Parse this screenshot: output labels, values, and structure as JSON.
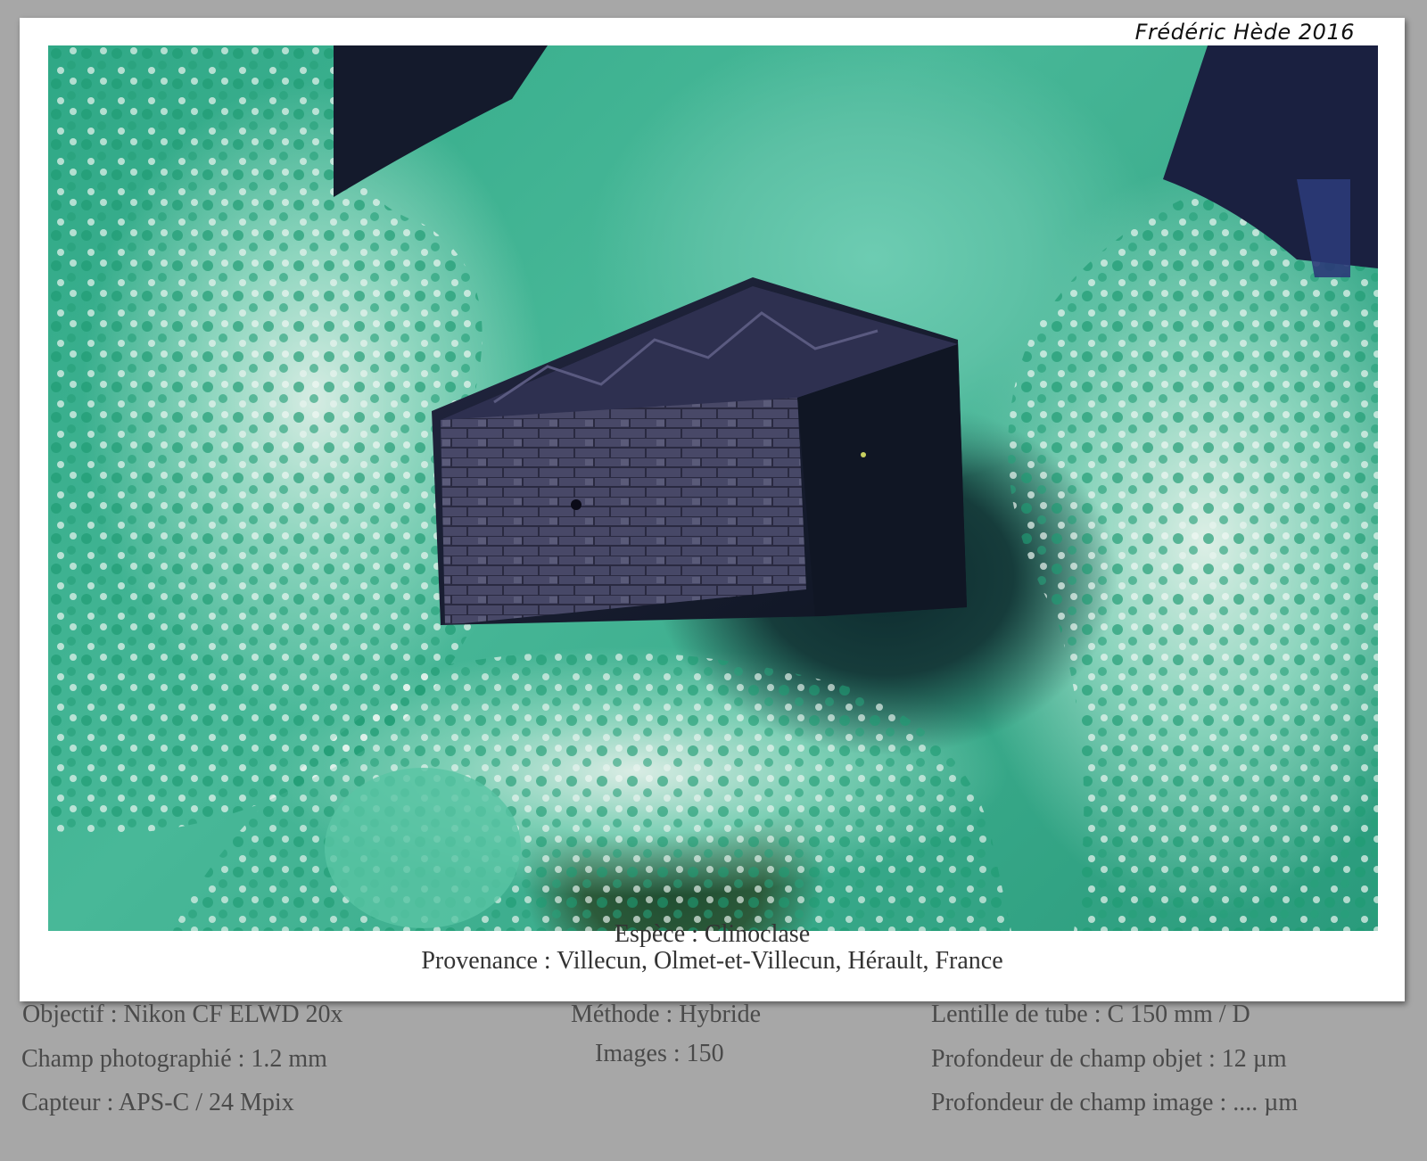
{
  "signature": "Frédéric Hède 2016",
  "caption": {
    "species": "Espèce : Clinoclase",
    "origin": "Provenance : Villecun, Olmet-et-Villecun, Hérault, France"
  },
  "specs": {
    "col1": [
      "Objectif : Nikon CF ELWD 20x",
      "Champ photographié : 1.2 mm",
      "Capteur : APS-C / 24 Mpix"
    ],
    "col2": [
      "Méthode : Hybride",
      "Images : 150"
    ],
    "col3": [
      "Lentille de tube : C 150 mm / D",
      "Profondeur de champ objet : 12 µm",
      "Profondeur de champ image : .... µm"
    ]
  },
  "colors": {
    "page_background": "#a7a7a7",
    "card": "#ffffff",
    "matrix_green": "#48b898",
    "crystal_dark": "#1c1e34"
  }
}
